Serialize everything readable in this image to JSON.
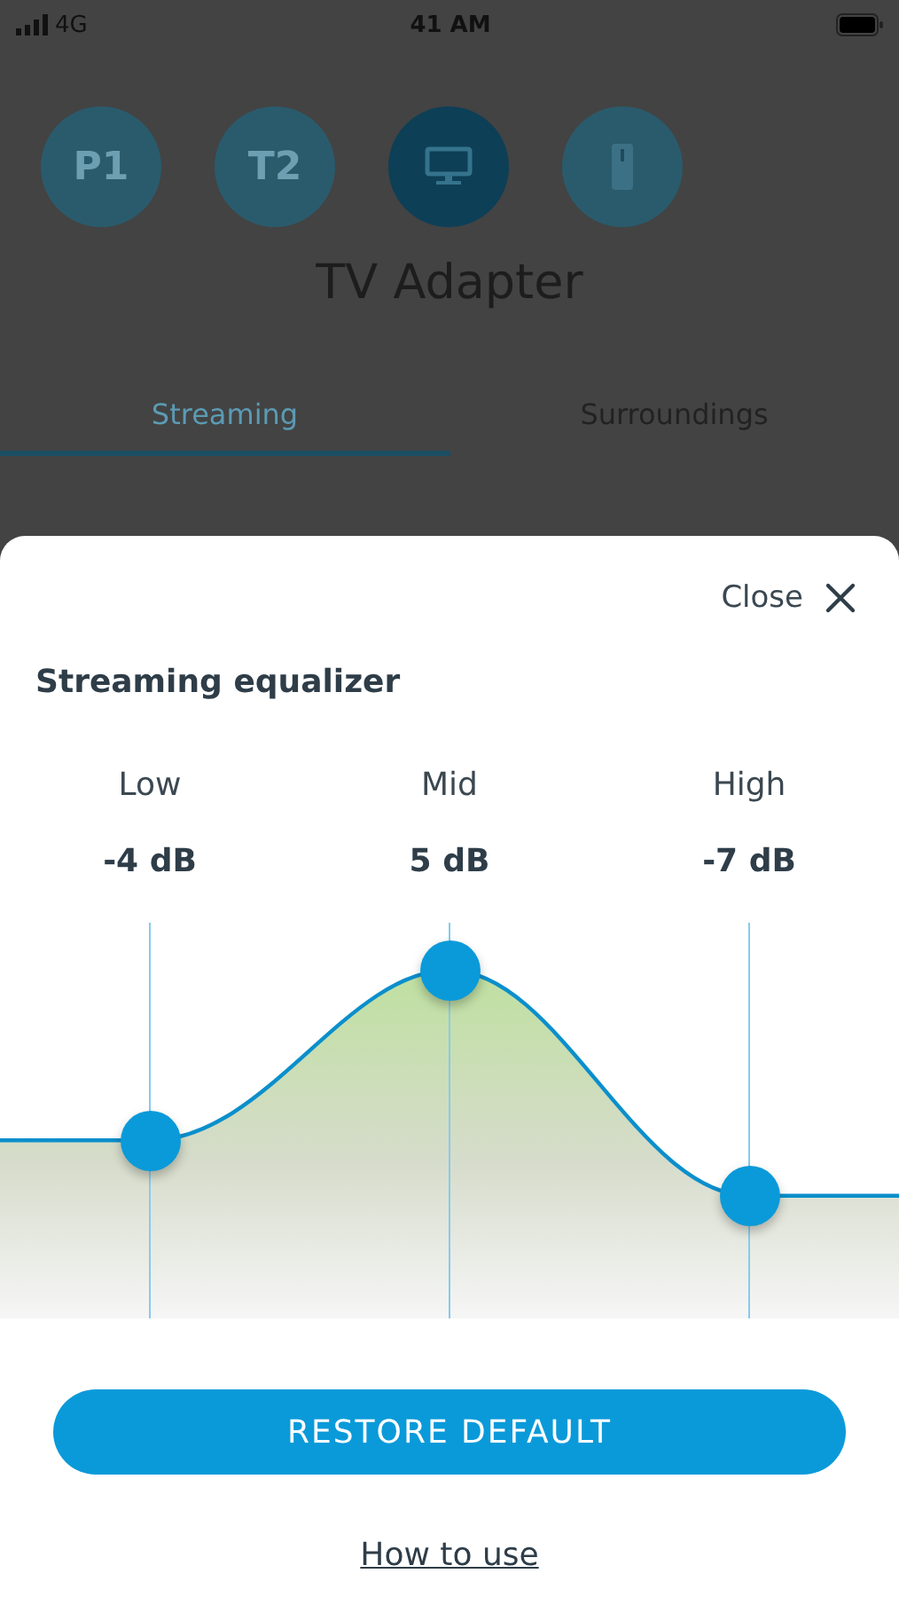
{
  "status_bar": {
    "network": "4G",
    "time": "41 AM"
  },
  "devices": [
    {
      "kind": "text",
      "label": "P1",
      "selected": false
    },
    {
      "kind": "text",
      "label": "T2",
      "selected": false
    },
    {
      "kind": "monitor",
      "selected": true
    },
    {
      "kind": "remote",
      "selected": false
    }
  ],
  "device_name": "TV Adapter",
  "tabs": [
    {
      "label": "Streaming",
      "selected": true
    },
    {
      "label": "Surroundings",
      "selected": false
    }
  ],
  "sheet": {
    "close_label": "Close",
    "title": "Streaming equalizer",
    "bands": [
      {
        "name": "Low",
        "reading": "-4 dB",
        "level": 0.45
      },
      {
        "name": "Mid",
        "reading": "5 dB",
        "level": 0.88
      },
      {
        "name": "High",
        "reading": "-7 dB",
        "level": 0.31
      }
    ],
    "restore_button": "RESTORE DEFAULT",
    "help_link": "How to use"
  }
}
